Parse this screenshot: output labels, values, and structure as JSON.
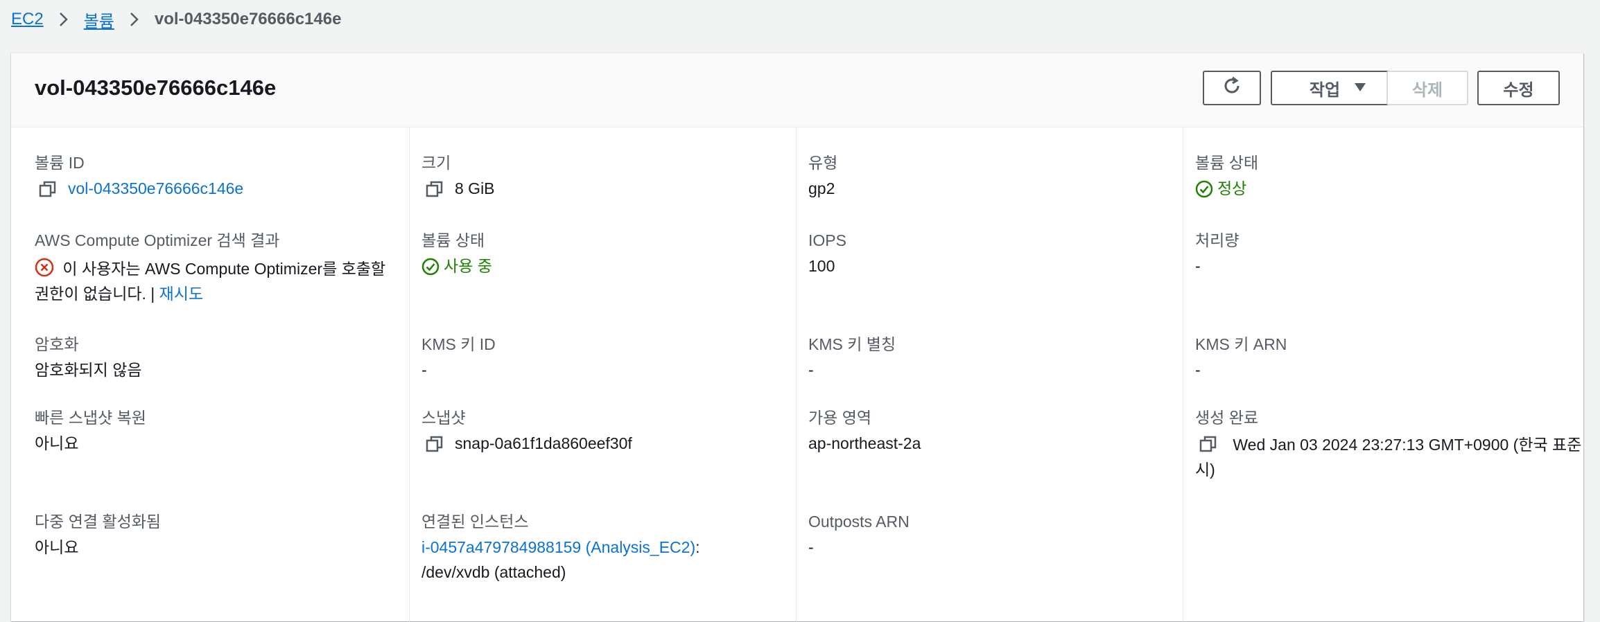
{
  "breadcrumb": {
    "items": [
      "EC2",
      "볼륨"
    ],
    "current": "vol-043350e76666c146e"
  },
  "header": {
    "title": "vol-043350e76666c146e",
    "actions_label": "작업",
    "delete_label": "삭제",
    "edit_label": "수정"
  },
  "colors": {
    "link": "#0972d3",
    "success": "#1d8102",
    "error": "#d13212"
  },
  "fields": {
    "volume_id": {
      "label": "볼륨 ID",
      "value": "vol-043350e76666c146e"
    },
    "size": {
      "label": "크기",
      "value": "8 GiB"
    },
    "type": {
      "label": "유형",
      "value": "gp2"
    },
    "volume_status": {
      "label": "볼륨 상태",
      "value": "정상"
    },
    "optimizer": {
      "label": "AWS Compute Optimizer 검색 결과",
      "error_text": "이 사용자는 AWS Compute Optimizer를 호출할 권한이 없습니다.",
      "separator": "|",
      "retry": "재시도"
    },
    "volume_state": {
      "label": "볼륨 상태",
      "value": "사용 중"
    },
    "iops": {
      "label": "IOPS",
      "value": "100"
    },
    "throughput": {
      "label": "처리량",
      "value": "-"
    },
    "encryption": {
      "label": "암호화",
      "value": "암호화되지 않음"
    },
    "kms_key_id": {
      "label": "KMS 키 ID",
      "value": "-"
    },
    "kms_key_alias": {
      "label": "KMS 키 별칭",
      "value": "-"
    },
    "kms_key_arn": {
      "label": "KMS 키 ARN",
      "value": "-"
    },
    "fast_snapshot_restore": {
      "label": "빠른 스냅샷 복원",
      "value": "아니요"
    },
    "snapshot": {
      "label": "스냅샷",
      "value": "snap-0a61f1da860eef30f"
    },
    "availability_zone": {
      "label": "가용 영역",
      "value": "ap-northeast-2a"
    },
    "created": {
      "label": "생성 완료",
      "value": "Wed Jan 03 2024 23:27:13 GMT+0900 (한국 표준시)"
    },
    "multi_attach": {
      "label": "다중 연결 활성화됨",
      "value": "아니요"
    },
    "attached_instances": {
      "label": "연결된 인스턴스",
      "instance_link": "i-0457a479784988159 (Analysis_EC2)",
      "suffix": ":",
      "device": "/dev/xvdb (attached)"
    },
    "outposts_arn": {
      "label": "Outposts ARN",
      "value": "-"
    }
  }
}
